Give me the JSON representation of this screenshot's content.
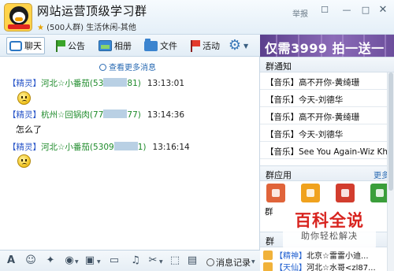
{
  "group": {
    "title": "网站运营顶级学习群",
    "member_count": "(500人群)",
    "category": "生活休闲-其他",
    "report_label": "举报"
  },
  "tabs": [
    {
      "label": "聊天",
      "icon": "chat-bubble-icon"
    },
    {
      "label": "公告",
      "icon": "green-flag-icon"
    },
    {
      "label": "相册",
      "icon": "photo-icon"
    },
    {
      "label": "文件",
      "icon": "folder-icon"
    },
    {
      "label": "活动",
      "icon": "red-flag-icon"
    }
  ],
  "chat": {
    "more_messages": "查看更多消息",
    "messages": [
      {
        "role": "【精灵】",
        "name": "河北☆小番茄",
        "qq_start": "(53",
        "qq_end": "81)",
        "time": "13:13:01",
        "content": "emoji-sad"
      },
      {
        "role": "【精灵】",
        "name": "杭州☆回锅肉",
        "qq_start": "(77",
        "qq_end": "77)",
        "time": "13:14:36",
        "content": "怎么了"
      },
      {
        "role": "【精灵】",
        "name": "河北☆小番茄",
        "qq_start": "(5309",
        "qq_end": "1)",
        "time": "13:16:14",
        "content": "emoji-sad"
      }
    ]
  },
  "input_toolbar": {
    "history_label": "消息记录"
  },
  "banner": {
    "text": "仅需3999 拍一送一"
  },
  "notices": {
    "title": "群通知",
    "items": [
      "【音乐】高不开你-黄绮珊",
      "【音乐】今天-刘德华",
      "【音乐】高不开你-黄绮珊",
      "【音乐】今天-刘德华",
      "【音乐】See You Again-Wiz Khalifa"
    ]
  },
  "apps": {
    "title": "群应用",
    "more_label": "更多",
    "first_label": "群",
    "colors": [
      "#e0643a",
      "#f0a21e",
      "#d23d2e",
      "#3a9e3a"
    ]
  },
  "members": {
    "title": "群",
    "items": [
      {
        "role": "【精神】",
        "text": "北京☆雷雷小迪..."
      },
      {
        "role": "【天仙】",
        "text": "河北☆水哥<zl87..."
      }
    ]
  },
  "watermark": {
    "main": "百科全说",
    "sub": "助你轻松解决"
  }
}
